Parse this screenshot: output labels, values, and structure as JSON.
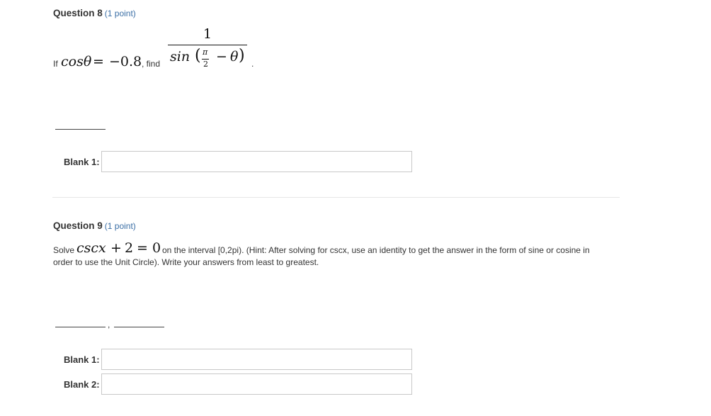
{
  "q8": {
    "number": "Question 8",
    "points": "(1 point)",
    "if_word": "If",
    "given": {
      "lhs": "cosθ",
      "eq": "=",
      "value": "−0.8"
    },
    "find_word": ", find",
    "numerator": "1",
    "denominator": {
      "fn": "sin",
      "lparen": "(",
      "pi": "π",
      "two": "2",
      "minus": "−",
      "theta": "θ",
      "rparen": ")"
    },
    "period": ".",
    "blanks": [
      {
        "label": "Blank 1:",
        "value": ""
      }
    ]
  },
  "q9": {
    "number": "Question 9",
    "points": "(1 point)",
    "solve_word": "Solve",
    "equation": {
      "fn": "cscx",
      "plus": "+",
      "num": "2",
      "eq": "=",
      "zero": "0"
    },
    "text_line1": "on the interval [0,2pi). (Hint: After solving for cscx, use an identity to get the answer in the form of sine or cosine in",
    "text_line2": "order to use the Unit Circle). Write your answers from least to greatest.",
    "separator": ",",
    "blanks": [
      {
        "label": "Blank 1:",
        "value": ""
      },
      {
        "label": "Blank 2:",
        "value": ""
      }
    ]
  }
}
